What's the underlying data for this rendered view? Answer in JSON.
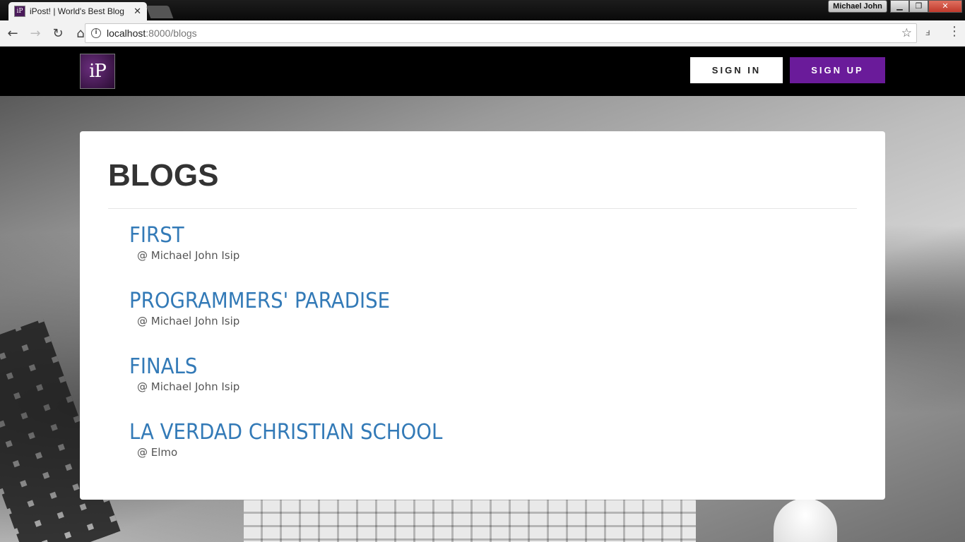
{
  "browser": {
    "tab_title": "iPost! | World's Best Blog",
    "tab_favicon_text": "iP",
    "tab_close": "✕",
    "profile_name": "Michael John",
    "url_host": "localhost",
    "url_path": ":8000/blogs",
    "window_buttons": {
      "minimize": "▁",
      "maximize": "❐",
      "close": "✕"
    }
  },
  "navbar": {
    "logo_text": "iP",
    "sign_in_label": "SIGN IN",
    "sign_up_label": "SIGN UP"
  },
  "main": {
    "heading": "BLOGS",
    "blogs": [
      {
        "title": "FIRST",
        "author": "@ Michael John Isip"
      },
      {
        "title": "PROGRAMMERS' PARADISE",
        "author": "@ Michael John Isip"
      },
      {
        "title": "FINALS",
        "author": "@ Michael John Isip"
      },
      {
        "title": "LA VERDAD CHRISTIAN SCHOOL",
        "author": "@ Elmo"
      }
    ]
  },
  "colors": {
    "brand_purple": "#6a1b9a",
    "link_blue": "#337ab7",
    "navbar_bg": "#000000"
  }
}
